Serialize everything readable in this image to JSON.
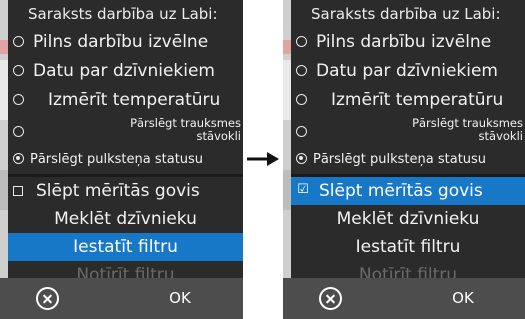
{
  "left_screen": {
    "menu_title": "Saraksts darbība uz Labi:",
    "options": [
      {
        "label": "Pilns darbību izvēlne",
        "selected": false
      },
      {
        "label": "Datu par dzīvniekiem",
        "selected": false
      },
      {
        "label": "Izmērīt temperatūru",
        "selected": false
      },
      {
        "label": "Pārslēgt trauksmes stāvokli",
        "selected": false
      },
      {
        "label": "Pārslēgt pulksteņa statusu",
        "selected": true
      }
    ],
    "hide_checkbox": {
      "label": "Slēpt mērītās govis",
      "checked": false
    },
    "actions": {
      "find_animal": "Meklēt dzīvnieku",
      "set_filter": "Iestatīt filtru",
      "clear_filter": "Notīrīt filtru"
    },
    "ok_label": "OK"
  },
  "right_screen": {
    "menu_title": "Saraksts darbība uz Labi:",
    "options": [
      {
        "label": "Pilns darbību izvēlne",
        "selected": false
      },
      {
        "label": "Datu par dzīvniekiem",
        "selected": false
      },
      {
        "label": "Izmērīt temperatūru",
        "selected": false
      },
      {
        "label": "Pārslēgt trauksmes stāvokli",
        "selected": false
      },
      {
        "label": "Pārslēgt pulksteņa statusu",
        "selected": true
      }
    ],
    "hide_checkbox": {
      "label": "Slēpt mērītās govis",
      "checked": true,
      "check_glyph": "☑"
    },
    "actions": {
      "find_animal": "Meklēt dzīvnieku",
      "set_filter": "Iestatīt filtru",
      "clear_filter": "Notīrīt filtru"
    },
    "ok_label": "OK"
  },
  "colors": {
    "highlight": "#1878c8",
    "menu_bg": "#2b2b2b",
    "bottom_bar": "#4d4d4d",
    "disabled_text": "#6a6a6a"
  },
  "icons": {
    "cancel": "close-circle-icon",
    "transition": "arrow-right-icon"
  }
}
